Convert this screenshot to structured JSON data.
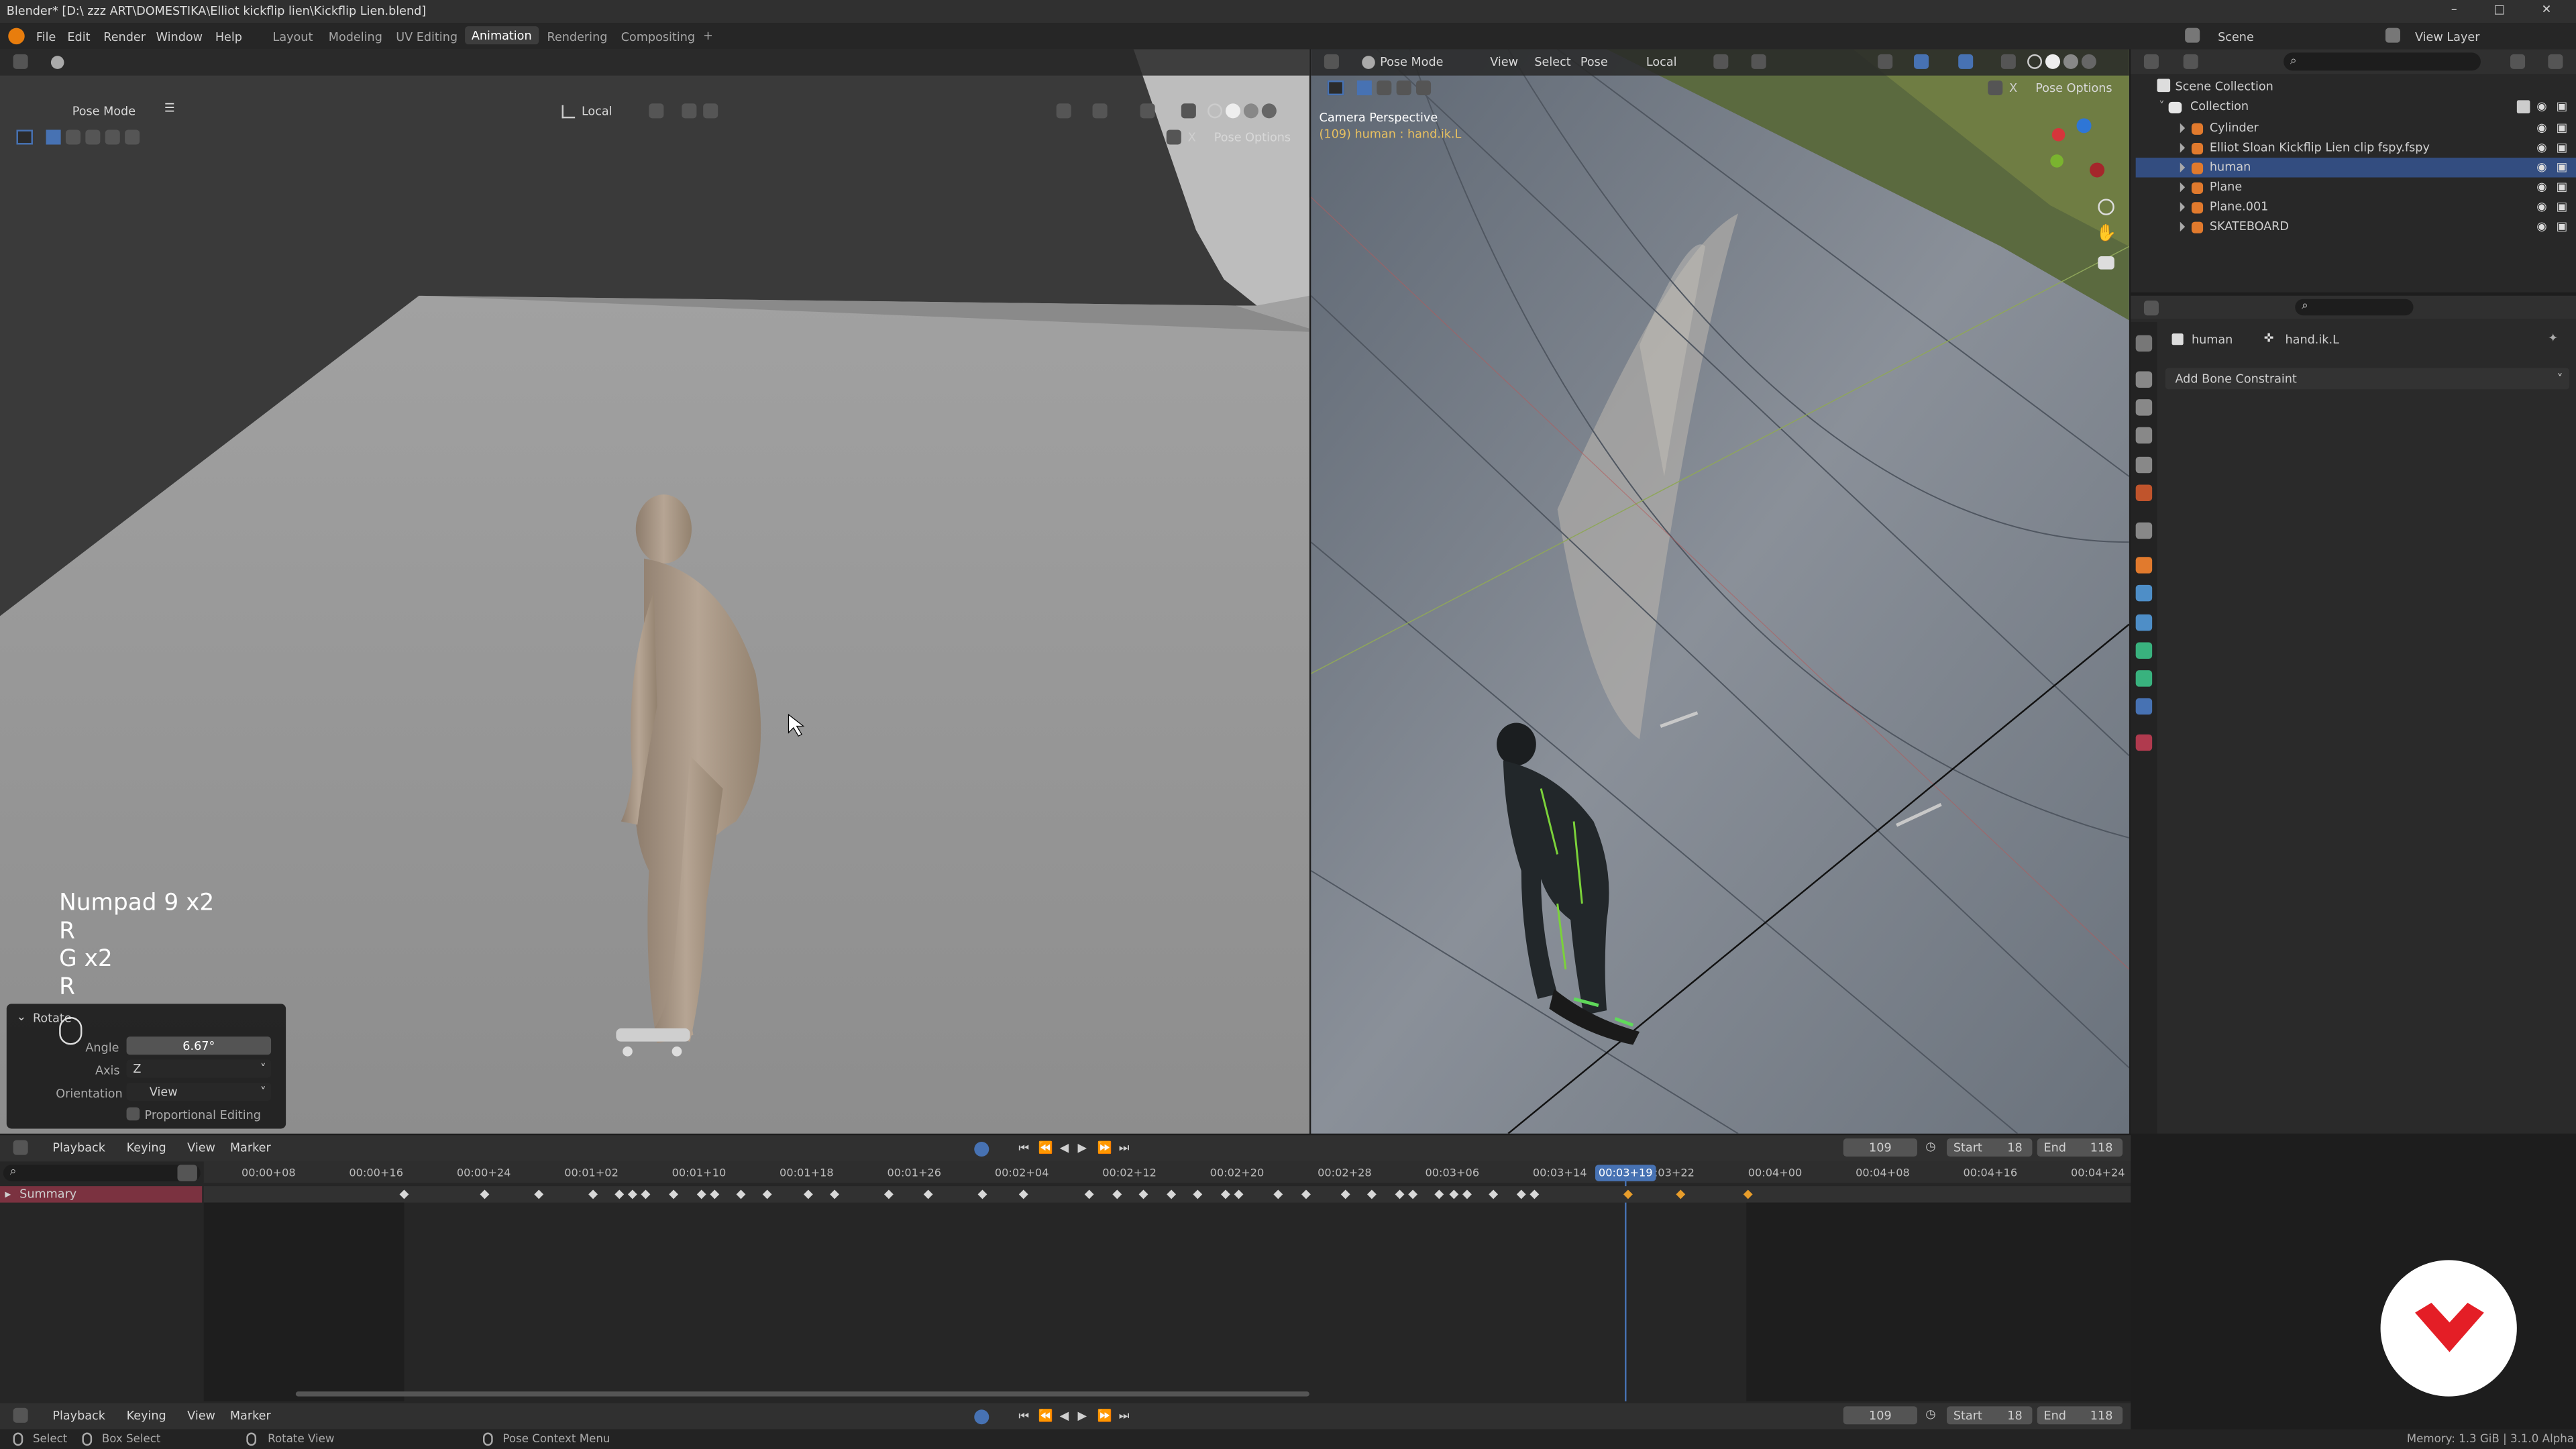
{
  "window": {
    "title": "Blender* [D:\\ zzz ART\\DOMESTIKA\\Elliot kickflip lien\\Kickflip Lien.blend]"
  },
  "menu": [
    "File",
    "Edit",
    "Render",
    "Window",
    "Help"
  ],
  "workspaces": [
    "Layout",
    "Modeling",
    "UV Editing",
    "Animation",
    "Rendering",
    "Compositing"
  ],
  "active_workspace": "Animation",
  "top_right": {
    "scene": "Scene",
    "view_layer": "View Layer"
  },
  "left_view": {
    "mode": "Pose Mode",
    "orientation": "Local",
    "pose_options": "Pose Options",
    "key_overlay": [
      "Numpad 9 x2",
      "R",
      "G x2",
      "R"
    ],
    "operator": {
      "title": "Rotate",
      "angle_label": "Angle",
      "angle": "6.67°",
      "axis_label": "Axis",
      "axis": "Z",
      "orientation_label": "Orientation",
      "orientation": "View",
      "proportional": "Proportional Editing"
    }
  },
  "right_view": {
    "mode": "Pose Mode",
    "menus": [
      "View",
      "Select",
      "Pose"
    ],
    "orientation": "Local",
    "pose_options": "Pose Options",
    "camera_label": "Camera Perspective",
    "bone_label": "(109) human : hand.ik.L"
  },
  "outliner": {
    "scene_collection": "Scene Collection",
    "collection": "Collection",
    "items": [
      "Cylinder",
      "Elliot Sloan Kickflip Lien clip fspy.fspy",
      "human",
      "Plane",
      "Plane.001",
      "SKATEBOARD"
    ],
    "selected": "human"
  },
  "properties": {
    "object": "human",
    "bone": "hand.ik.L",
    "add_constraint": "Add Bone Constraint"
  },
  "timeline": {
    "menus": [
      "Playback",
      "Keying",
      "View",
      "Marker"
    ],
    "current_frame": "109",
    "start_label": "Start",
    "start": "18",
    "end_label": "End",
    "end": "118",
    "summary": "Summary",
    "current_time": "00:03+19",
    "ticks": [
      "00:00+08",
      "00:00+16",
      "00:00+24",
      "00:01+02",
      "00:01+10",
      "00:01+18",
      "00:01+26",
      "00:02+04",
      "00:02+12",
      "00:02+20",
      "00:02+28",
      "00:03+06",
      "00:03+14",
      "00:03+22",
      "00:04+00",
      "00:04+08",
      "00:04+16",
      "00:04+24"
    ]
  },
  "statusbar": {
    "select": "Select",
    "box_select": "Box Select",
    "rotate_view": "Rotate View",
    "context_menu": "Pose Context Menu",
    "memory": "Memory: 1.3 GiB | 3.1.0 Alpha"
  },
  "colors": {
    "accent": "#4772b3",
    "key_selected": "#e89d2b",
    "logo": "#e41e26"
  }
}
